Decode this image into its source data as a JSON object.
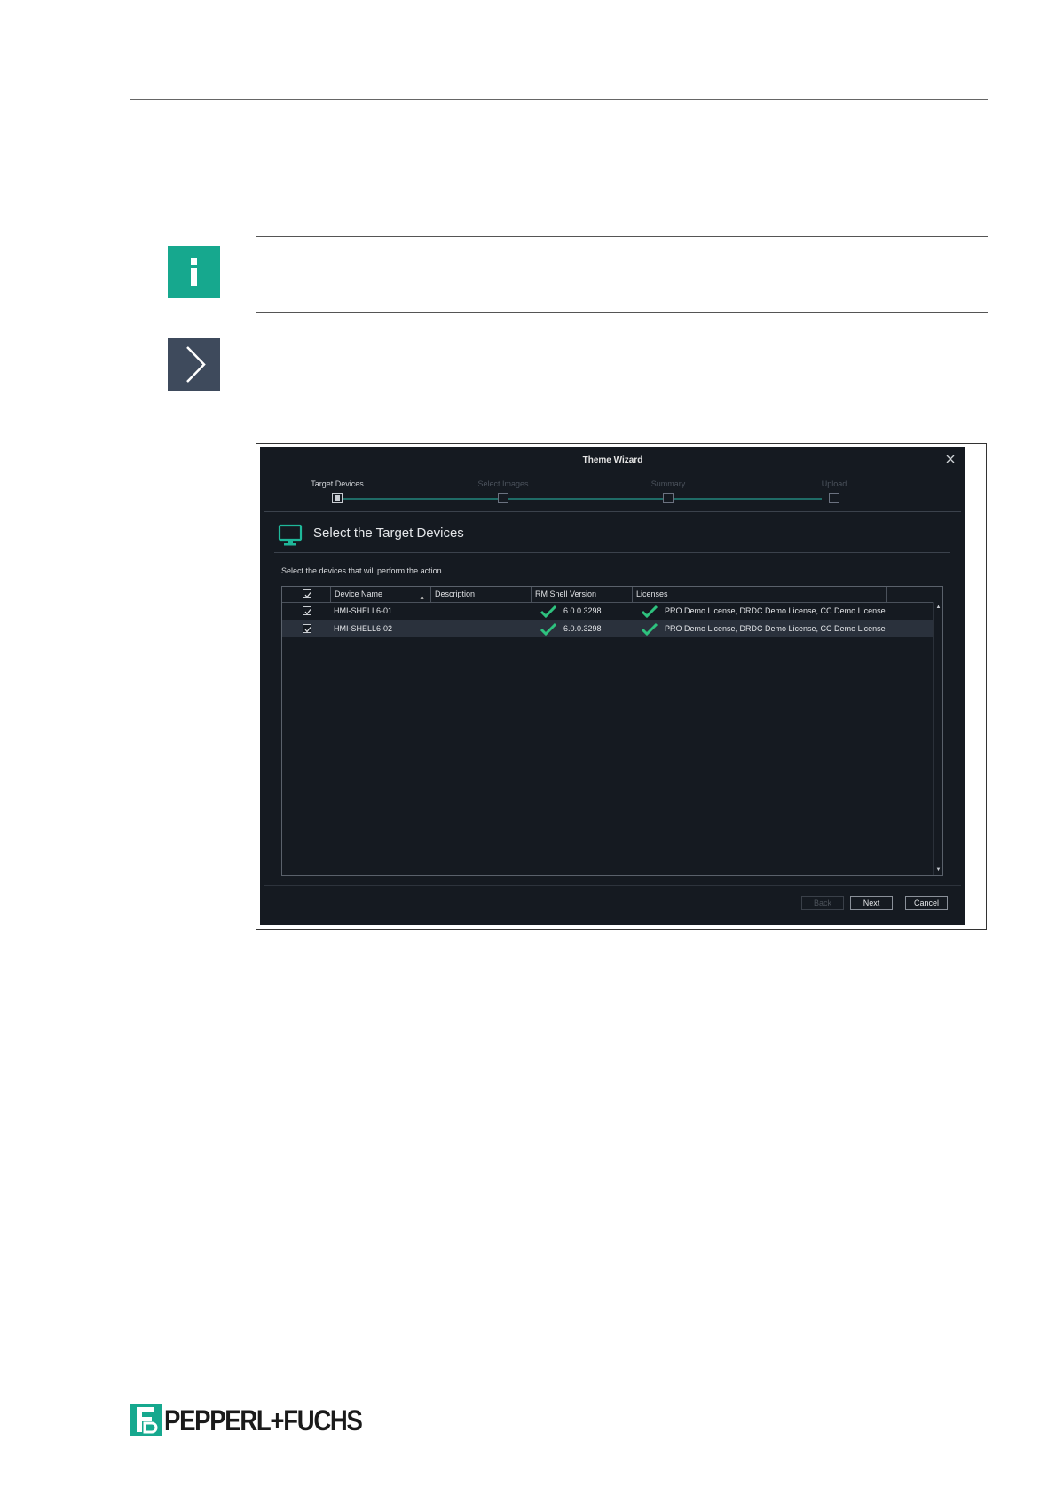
{
  "wizard": {
    "title": "Theme Wizard",
    "steps": [
      {
        "label": "Target Devices",
        "active": true
      },
      {
        "label": "Select Images",
        "active": false
      },
      {
        "label": "Summary",
        "active": false
      },
      {
        "label": "Upload",
        "active": false
      }
    ],
    "heading": "Select the Target Devices",
    "instruction": "Select the devices that will perform the action.",
    "table": {
      "columns": [
        "Device Name",
        "Description",
        "RM Shell Version",
        "Licenses"
      ],
      "rows": [
        {
          "device": "HMI-SHELL6-01",
          "description": "",
          "version": "6.0.0.3298",
          "licenses": "PRO Demo License, DRDC Demo License, CC Demo License",
          "checked": true
        },
        {
          "device": "HMI-SHELL6-02",
          "description": "",
          "version": "6.0.0.3298",
          "licenses": "PRO Demo License, DRDC Demo License, CC Demo License",
          "checked": true
        }
      ]
    },
    "buttons": {
      "back": "Back",
      "next": "Next",
      "cancel": "Cancel"
    }
  },
  "footer": {
    "brand": "PEPPERL+FUCHS"
  },
  "colors": {
    "accent": "#16a88e",
    "dark_bg": "#151a21",
    "arrow_box": "#3e4a5c",
    "check": "#2ec27e"
  },
  "icons": [
    "info-icon",
    "chevron-right-icon",
    "close-icon",
    "monitor-icon",
    "checkmark-icon",
    "checkbox-icon",
    "scroll-up-icon",
    "scroll-down-icon",
    "sort-ascending-icon",
    "brand-logo-icon"
  ]
}
